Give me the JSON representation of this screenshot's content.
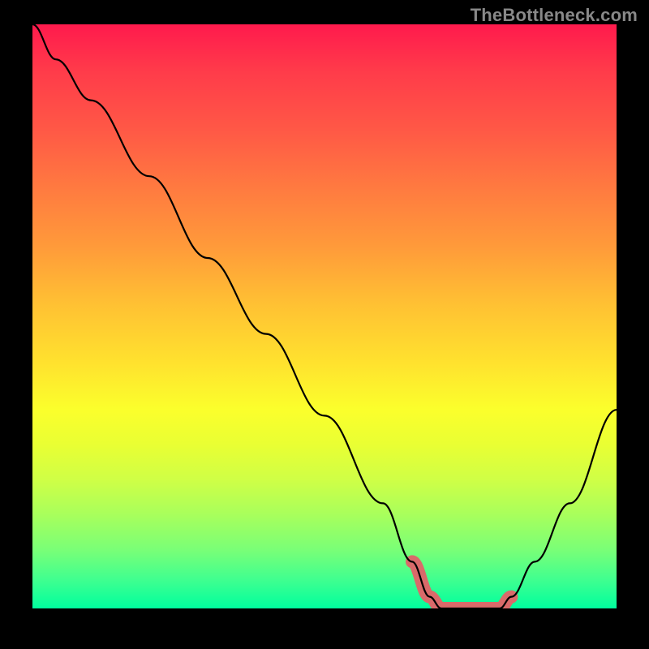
{
  "watermark": "TheBottleneck.com",
  "chart_data": {
    "type": "line",
    "title": "",
    "xlabel": "",
    "ylabel": "",
    "xlim": [
      0,
      100
    ],
    "ylim": [
      0,
      100
    ],
    "series": [
      {
        "name": "curve",
        "x": [
          0,
          4,
          10,
          20,
          30,
          40,
          50,
          60,
          65,
          68,
          70,
          75,
          80,
          82,
          86,
          92,
          100
        ],
        "y": [
          100,
          94,
          87,
          74,
          60,
          47,
          33,
          18,
          8,
          2,
          0,
          0,
          0,
          2,
          8,
          18,
          34
        ]
      }
    ],
    "highlight": {
      "name": "bottleneck-zone",
      "x": [
        65,
        68,
        70,
        75,
        80,
        82
      ],
      "y": [
        8,
        2,
        0,
        0,
        0,
        2
      ],
      "color": "#d96a6a",
      "width": 16
    },
    "gradient_stops": [
      {
        "pos": 0,
        "color": "#ff1a4d"
      },
      {
        "pos": 50,
        "color": "#ffe22e"
      },
      {
        "pos": 100,
        "color": "#00ff9e"
      }
    ]
  }
}
